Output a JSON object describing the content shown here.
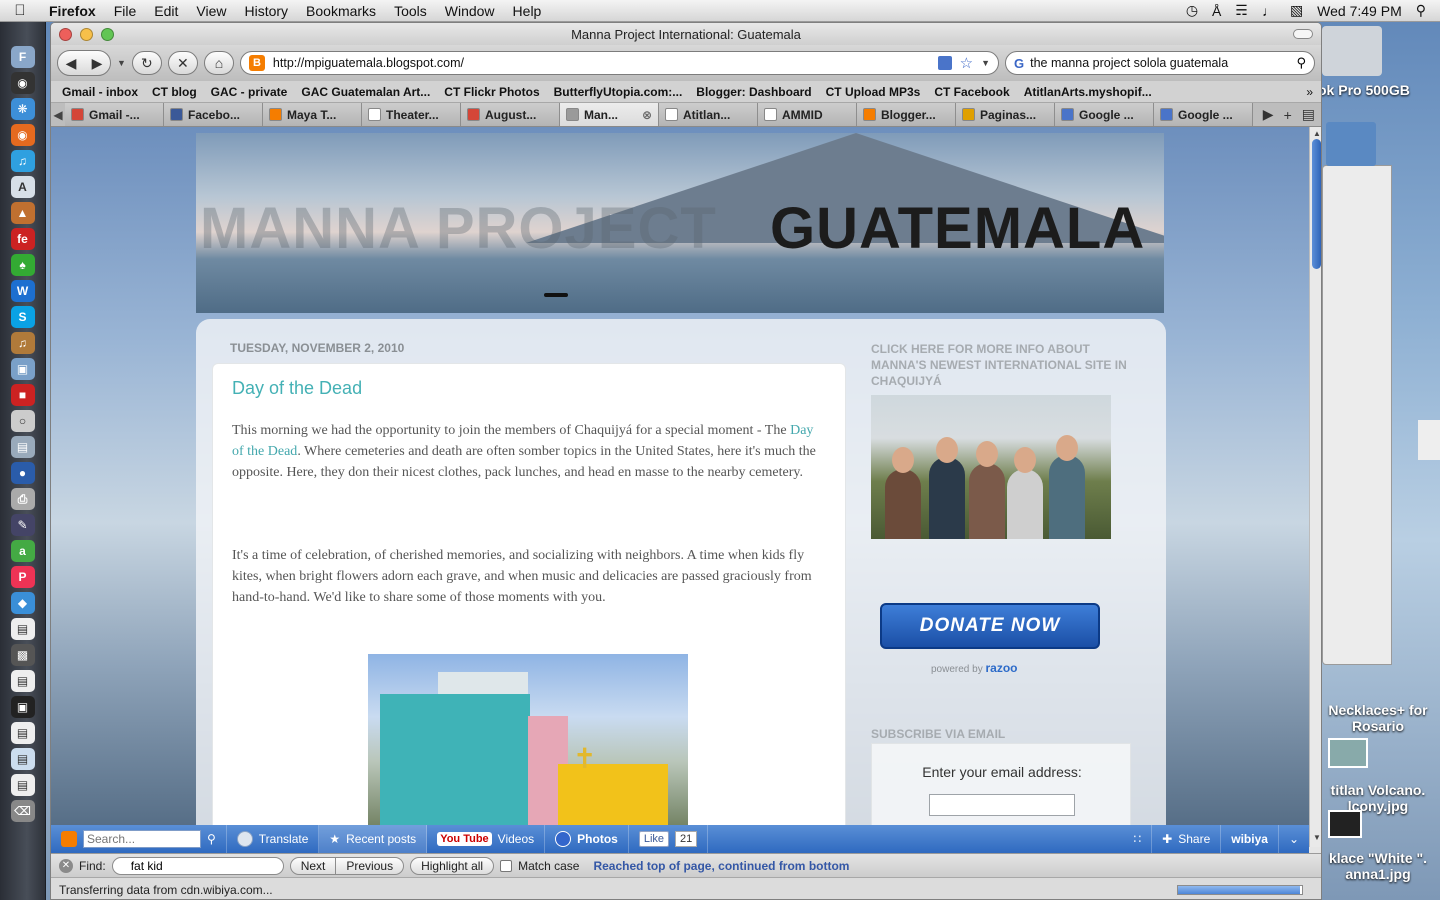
{
  "menubar": {
    "app": "Firefox",
    "items": [
      "File",
      "Edit",
      "View",
      "History",
      "Bookmarks",
      "Tools",
      "Window",
      "Help"
    ],
    "clock": "Wed 7:49 PM"
  },
  "window": {
    "title": "Manna Project International: Guatemala"
  },
  "navbar": {
    "url": "http://mpiguatemala.blogspot.com/",
    "search_query": "the manna project solola guatemala"
  },
  "bookmarks": [
    "Gmail - inbox",
    "CT blog",
    "GAC - private",
    "GAC Guatemalan Art...",
    "CT Flickr Photos",
    "ButterflyUtopia.com:...",
    "Blogger: Dashboard",
    "CT Upload MP3s",
    "CT Facebook",
    "AtitlanArts.myshopif..."
  ],
  "tabs": [
    {
      "label": "Gmail -...",
      "color": "#d44638"
    },
    {
      "label": "Facebo...",
      "color": "#3b5998"
    },
    {
      "label": "Maya T...",
      "color": "#f57d00"
    },
    {
      "label": "Theater...",
      "color": "#ffffff"
    },
    {
      "label": "August...",
      "color": "#d44638"
    },
    {
      "label": "Man...",
      "color": "#9a9a9a"
    },
    {
      "label": "Atitlan...",
      "color": "#ffffff"
    },
    {
      "label": "AMMID",
      "color": "#ffffff"
    },
    {
      "label": "Blogger...",
      "color": "#f57d00"
    },
    {
      "label": "Paginas...",
      "color": "#e0a000"
    },
    {
      "label": "Google ...",
      "color": "#4a74c9"
    },
    {
      "label": "Google ...",
      "color": "#4a74c9"
    }
  ],
  "blog": {
    "header_ghost": "MANNA PROJECT",
    "header_main": "GUATEMALA",
    "date": "TUESDAY, NOVEMBER 2, 2010",
    "post_title": "Day of the Dead",
    "p1_before": "This morning we had the opportunity to join the members of Chaquijyá for a special moment - The ",
    "p1_link": "Day of the Dead",
    "p1_after": ".  Where cemeteries and death are often somber topics in the United States, here it's much the opposite.  Here, they don their nicest clothes, pack lunches, and head en masse to the nearby cemetery.",
    "p2": "It's a time of celebration, of cherished memories, and socializing with neighbors.  A time when kids fly kites, when bright flowers adorn each grave, and when music and delicacies are passed graciously from hand-to-hand.  We'd like to share some of those moments with you."
  },
  "sidebar": {
    "info_heading": "CLICK HERE FOR MORE INFO ABOUT MANNA'S NEWEST INTERNATIONAL SITE IN CHAQUIJYÁ",
    "donate_label": "DONATE NOW",
    "powered_by": "powered by",
    "powered_brand": "razoo",
    "subscribe_heading": "SUBSCRIBE VIA EMAIL",
    "email_label": "Enter your email address:"
  },
  "wibiya": {
    "search_placeholder": "Search...",
    "translate": "Translate",
    "recent_posts": "Recent posts",
    "youtube": "You Tube",
    "videos": "Videos",
    "photos": "Photos",
    "like": "Like",
    "like_count": "21",
    "share": "Share",
    "brand": "wibiya"
  },
  "findbar": {
    "label": "Find:",
    "query": "fat kid",
    "next": "Next",
    "previous": "Previous",
    "highlight_all": "Highlight all",
    "match_case": "Match case",
    "status": "Reached top of page, continued from bottom"
  },
  "statusbar": {
    "text": "Transferring data from cdn.wibiya.com...",
    "progress": 0.98
  },
  "desktop": {
    "drive_label": "ok Pro 500GB",
    "item_necklaces": "Necklaces+ for Rosario",
    "item_volcano": "titlan Volcano. lcony.jpg",
    "item_klace": "klace \"White \". anna1.jpg"
  },
  "colors": {
    "post_title": "#44b1b5",
    "donate": "#1b4fa6",
    "wibiya_bar": "#2f6ac0"
  }
}
